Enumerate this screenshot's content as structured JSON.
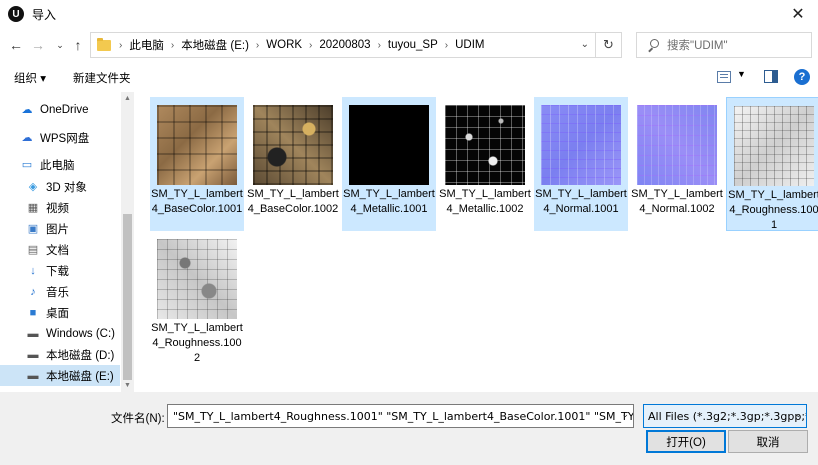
{
  "window": {
    "title": "导入",
    "app_icon_glyph": "U"
  },
  "address": {
    "crumbs": [
      "此电脑",
      "本地磁盘 (E:)",
      "WORK",
      "20200803",
      "tuyou_SP",
      "UDIM"
    ]
  },
  "search": {
    "placeholder": "搜索\"UDIM\""
  },
  "toolbar": {
    "organize": "组织 ▾",
    "new_folder": "新建文件夹"
  },
  "nav": {
    "items": [
      {
        "label": "OneDrive",
        "icon": "cloud-icon"
      },
      {
        "label": "WPS网盘",
        "icon": "wps-cloud-icon"
      },
      {
        "label": "此电脑",
        "icon": "computer-icon"
      },
      {
        "label": "3D 对象",
        "icon": "3d-objects-icon"
      },
      {
        "label": "视频",
        "icon": "video-icon"
      },
      {
        "label": "图片",
        "icon": "pictures-icon"
      },
      {
        "label": "文档",
        "icon": "documents-icon"
      },
      {
        "label": "下载",
        "icon": "downloads-icon"
      },
      {
        "label": "音乐",
        "icon": "music-icon"
      },
      {
        "label": "桌面",
        "icon": "desktop-icon"
      },
      {
        "label": "Windows (C:)",
        "icon": "drive-icon"
      },
      {
        "label": "本地磁盘 (D:)",
        "icon": "drive-icon"
      },
      {
        "label": "本地磁盘 (E:)",
        "icon": "drive-icon"
      }
    ],
    "selected": "本地磁盘 (E:)"
  },
  "files": [
    {
      "name": "SM_TY_L_lambert4_BaseColor.1001",
      "selected": true
    },
    {
      "name": "SM_TY_L_lambert4_BaseColor.1002",
      "selected": false
    },
    {
      "name": "SM_TY_L_lambert4_Metallic.1001",
      "selected": true
    },
    {
      "name": "SM_TY_L_lambert4_Metallic.1002",
      "selected": false
    },
    {
      "name": "SM_TY_L_lambert4_Normal.1001",
      "selected": true
    },
    {
      "name": "SM_TY_L_lambert4_Normal.1002",
      "selected": false
    },
    {
      "name": "SM_TY_L_lambert4_Roughness.1001",
      "selected": true
    },
    {
      "name": "SM_TY_L_lambert4_Roughness.1002",
      "selected": false
    }
  ],
  "footer": {
    "filename_label": "文件名(N):",
    "filename_value": "\"SM_TY_L_lambert4_Roughness.1001\" \"SM_TY_L_lambert4_BaseColor.1001\" \"SM_TY_L_lan",
    "filter_value": "All Files (*.3g2;*.3gp;*.3gpp;*",
    "open_label": "打开(O)",
    "cancel_label": "取消"
  }
}
